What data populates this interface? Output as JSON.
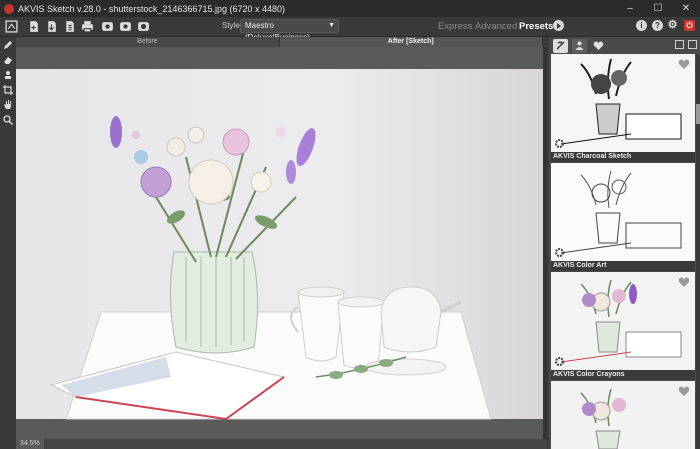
{
  "window": {
    "title": "AKVIS Sketch v.28.0 - shutterstock_2146366715.jpg (6720 x 4480)",
    "controls": [
      "–",
      "☐",
      "✕"
    ]
  },
  "toolbar": {
    "icons": [
      "home-icon",
      "open-icon",
      "save-icon",
      "print-icon",
      "batch-icon",
      "share-icon",
      "plugin-icon",
      "preferences-icon"
    ],
    "style_label": "Style:",
    "style_value": "Maestro (Deluxe|Business)",
    "modes": {
      "express": "Express",
      "advanced": "Advanced",
      "presets": "Presets"
    },
    "right_icons": {
      "info": "i",
      "help": "?",
      "settings": "⚙",
      "close": "⏻"
    }
  },
  "tools": [
    "pencil-icon",
    "eraser-icon",
    "stamp-icon",
    "crop-icon",
    "hand-icon",
    "zoom-icon"
  ],
  "tabs": {
    "before": "Before",
    "after": "After [Sketch]"
  },
  "status": {
    "zoom": "34.5%"
  },
  "presets_panel": {
    "tab_icons": [
      "artist-icon",
      "user-icon",
      "favorites-icon"
    ],
    "items": [
      {
        "name": "AKVIS Charcoal Sketch"
      },
      {
        "name": "AKVIS Color Art"
      },
      {
        "name": "AKVIS Color Crayons"
      },
      {
        "name": ""
      }
    ]
  },
  "colors": {
    "accent": "#c8352e",
    "bg": "#3c3c3c",
    "panel": "#4a4a4a"
  }
}
